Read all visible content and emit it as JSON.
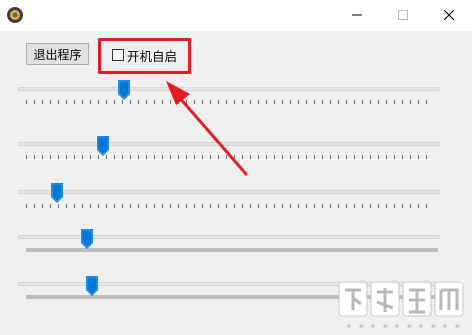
{
  "window": {
    "controls": {
      "minimize": "minimize-icon",
      "maximize": "maximize-icon",
      "close": "close-icon"
    }
  },
  "toolbar": {
    "exit_label": "退出程序",
    "autostart_label": "开机自启",
    "autostart_checked": false
  },
  "sliders": [
    {
      "value": 0.23,
      "ticks": true
    },
    {
      "value": 0.18,
      "ticks": true
    },
    {
      "value": 0.08,
      "ticks": true
    },
    {
      "value": 0.16,
      "ticks": false
    },
    {
      "value": 0.17,
      "ticks": false
    }
  ],
  "annotation": {
    "highlight_color": "#e51c23",
    "arrow_color": "#e51c23"
  },
  "accent_color": "#0078d7"
}
